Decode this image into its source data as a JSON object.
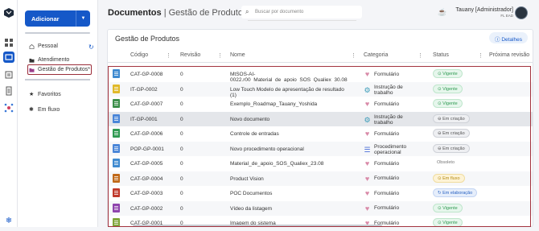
{
  "sidebar": {
    "add_label": "Adicionar",
    "nav": {
      "pessoal": "Pessoal",
      "atendimento": "Atendimento",
      "gestao": "Gestão de Produtos*",
      "favoritos": "Favoritos",
      "em_fluxo": "Em fluxo"
    }
  },
  "header": {
    "title": "Documentos",
    "subtitle": "Gestão de Produtos",
    "search_placeholder": "Buscar por documento",
    "user_name": "Tauany [Administrador]",
    "user_role": "FL EAD"
  },
  "panel": {
    "title": "Gestão de Produtos",
    "details_label": "Detalhes",
    "columns": [
      "Código",
      "Revisão",
      "Nome",
      "Categoria",
      "Status",
      "Próxima revisão"
    ]
  },
  "rows": [
    {
      "code": "CAT-GP-0008",
      "rev": "0",
      "name": "MtSOS-AI-0022.r00_Material_de_apoio_SOS_Qualiex_30.08",
      "cat": "Formulário",
      "status": "Vigente",
      "icon_color": "#3f8ad0",
      "cat_icon": "heart",
      "badge": "green"
    },
    {
      "code": "IT-GP-0002",
      "rev": "0",
      "name": "Low Touch Modelo de apresentação de resultado (1)",
      "cat": "Instrução de trabalho",
      "status": "Vigente",
      "icon_color": "#e0b929",
      "cat_icon": "gear",
      "badge": "green"
    },
    {
      "code": "CAT-GP-0007",
      "rev": "0",
      "name": "Exemplo_Roadmap_Tauany_Yoshida",
      "cat": "Formulário",
      "status": "Vigente",
      "icon_color": "#3c8f4a",
      "cat_icon": "heart",
      "badge": "green"
    },
    {
      "code": "IT-GP-0001",
      "rev": "0",
      "name": "Novo documento",
      "cat": "Instrução de trabalho",
      "status": "Em criação",
      "icon_color": "#4a86d8",
      "cat_icon": "gear",
      "badge": "grey"
    },
    {
      "code": "CAT-GP-0006",
      "rev": "0",
      "name": "Controle de entradas",
      "cat": "Formulário",
      "status": "Em criação",
      "icon_color": "#2f9a52",
      "cat_icon": "heart",
      "badge": "grey"
    },
    {
      "code": "POP-GP-0001",
      "rev": "0",
      "name": "Novo procedimento operacional",
      "cat": "Procedimento operacional",
      "status": "Em criação",
      "icon_color": "#4a86d8",
      "cat_icon": "list",
      "badge": "grey"
    },
    {
      "code": "CAT-GP-0005",
      "rev": "0",
      "name": "Material_de_apoio_SOS_Qualiex_23.08",
      "cat": "Formulário",
      "status": "Obsoleto",
      "icon_color": "#3f8ad0",
      "cat_icon": "heart",
      "badge": "plain"
    },
    {
      "code": "CAT-GP-0004",
      "rev": "0",
      "name": "Product Vision",
      "cat": "Formulário",
      "status": "Em fluxo",
      "icon_color": "#c06a1a",
      "cat_icon": "heart",
      "badge": "yellow"
    },
    {
      "code": "CAT-GP-0003",
      "rev": "0",
      "name": "POC Documentos",
      "cat": "Formulário",
      "status": "Em elaboração",
      "icon_color": "#c0392b",
      "cat_icon": "heart",
      "badge": "blue"
    },
    {
      "code": "CAT-GP-0002",
      "rev": "0",
      "name": "Vídeo da listagem",
      "cat": "Formulário",
      "status": "Vigente",
      "icon_color": "#8e44ad",
      "cat_icon": "heart",
      "badge": "green"
    },
    {
      "code": "CAT-GP-0001",
      "rev": "0",
      "name": "Imagem do sistema",
      "cat": "Formulário",
      "status": "Vigente",
      "icon_color": "#7fa63a",
      "cat_icon": "heart",
      "badge": "green"
    }
  ],
  "colors": {
    "accent": "#1558c8",
    "highlight_border": "#a3343f",
    "heart": "#d98aa8",
    "gear": "#3a9bb8",
    "list": "#4a6fd8"
  }
}
